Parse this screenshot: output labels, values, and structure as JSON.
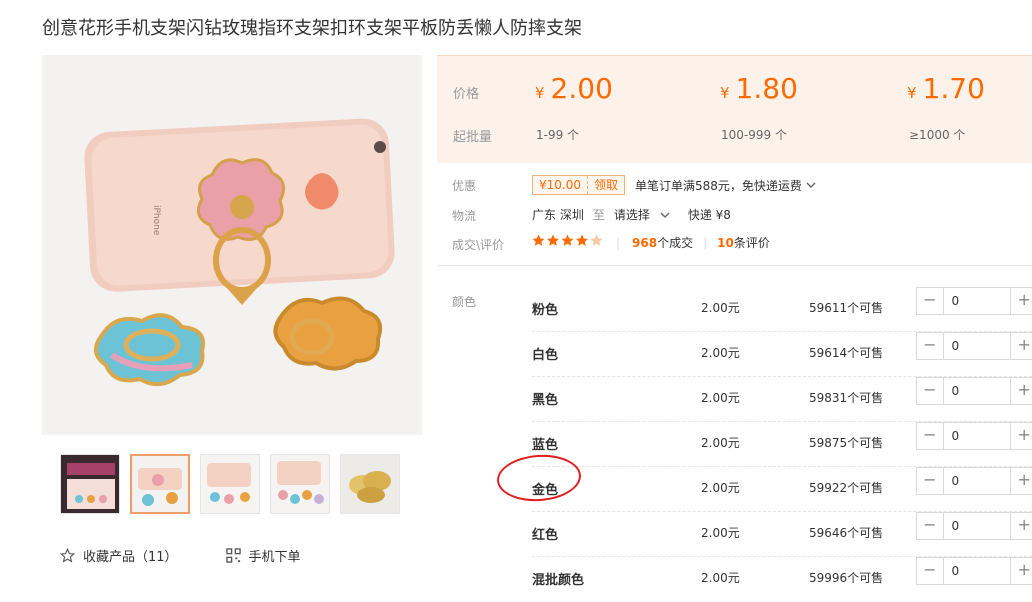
{
  "product": {
    "title": "创意花形手机支架闪钻玫瑰指环支架扣环支架平板防丢懒人防摔支架",
    "thumbnails": [
      {
        "name": "thumb-box-packaging"
      },
      {
        "name": "thumb-phone-ring-selected"
      },
      {
        "name": "thumb-phone-rings"
      },
      {
        "name": "thumb-phone-rings-2"
      },
      {
        "name": "thumb-gold-rings"
      }
    ],
    "favorite_label": "收藏产品（11）",
    "mobile_order_label": "手机下单"
  },
  "pricing": {
    "price_label": "价格",
    "qty_label": "起批量",
    "currency": "¥",
    "tiers": [
      {
        "price": "2.00",
        "qty": "1-99 个"
      },
      {
        "price": "1.80",
        "qty": "100-999 个"
      },
      {
        "price": "1.70",
        "qty": "≥1000 个"
      }
    ]
  },
  "info": {
    "promo_label": "优惠",
    "coupon_amount": "¥10.00",
    "coupon_action": "领取",
    "promo_text": "单笔订单满588元，免快递运费",
    "logistics_label": "物流",
    "origin": "广东 深圳",
    "to": "至",
    "destination_select": "请选择",
    "shipping": "快递 ¥8",
    "deals_label": "成交\\评价",
    "rating_stars": 4.5,
    "deals_count": "968",
    "deals_suffix": "个成交",
    "reviews_count": "10",
    "reviews_suffix": "条评价"
  },
  "sku": {
    "label": "颜色",
    "rows": [
      {
        "color": "粉色",
        "price": "2.00元",
        "stock": "59611个可售",
        "qty": "0"
      },
      {
        "color": "白色",
        "price": "2.00元",
        "stock": "59614个可售",
        "qty": "0"
      },
      {
        "color": "黑色",
        "price": "2.00元",
        "stock": "59831个可售",
        "qty": "0"
      },
      {
        "color": "蓝色",
        "price": "2.00元",
        "stock": "59875个可售",
        "qty": "0"
      },
      {
        "color": "金色",
        "price": "2.00元",
        "stock": "59922个可售",
        "qty": "0"
      },
      {
        "color": "红色",
        "price": "2.00元",
        "stock": "59646个可售",
        "qty": "0"
      },
      {
        "color": "混批颜色",
        "price": "2.00元",
        "stock": "59996个可售",
        "qty": "0"
      }
    ]
  },
  "colors": {
    "accent": "#ff6a00",
    "price_bg": "#fdf2ea",
    "annotation_circle": "#e02020"
  }
}
